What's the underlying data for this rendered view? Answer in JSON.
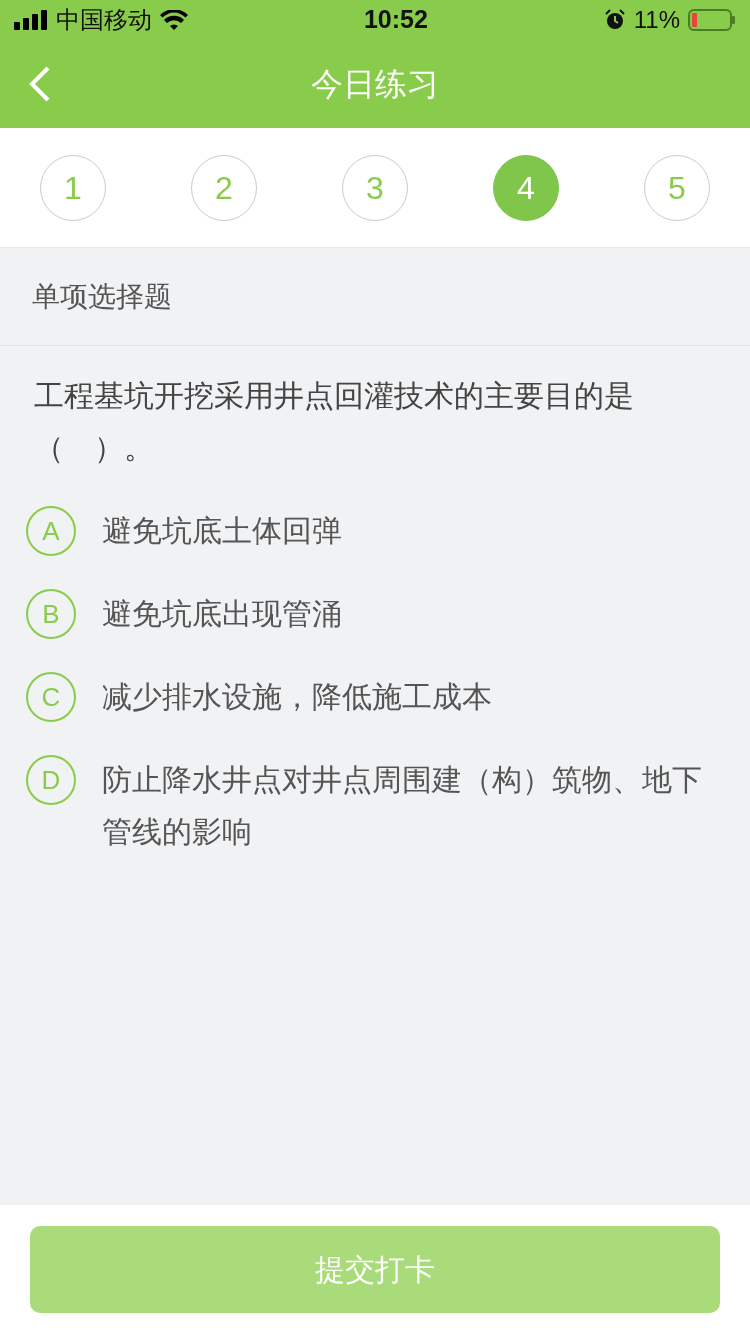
{
  "status_bar": {
    "carrier": "中国移动",
    "time": "10:52",
    "battery": "11%"
  },
  "nav": {
    "title": "今日练习"
  },
  "steps": [
    {
      "label": "1",
      "selected": false
    },
    {
      "label": "2",
      "selected": false
    },
    {
      "label": "3",
      "selected": false
    },
    {
      "label": "4",
      "selected": true
    },
    {
      "label": "5",
      "selected": false
    }
  ],
  "question": {
    "type": "单项选择题",
    "text": "工程基坑开挖采用井点回灌技术的主要目的是（　）。",
    "options": [
      {
        "letter": "A",
        "text": "避免坑底土体回弹",
        "selected": false
      },
      {
        "letter": "B",
        "text": "避免坑底出现管涌",
        "selected": false
      },
      {
        "letter": "C",
        "text": "减少排水设施，降低施工成本",
        "selected": false
      },
      {
        "letter": "D",
        "text": "防止降水井点对井点周围建（构）筑物、地下管线的影响",
        "selected": false
      }
    ]
  },
  "submit": {
    "label": "提交打卡",
    "disabled": true
  }
}
